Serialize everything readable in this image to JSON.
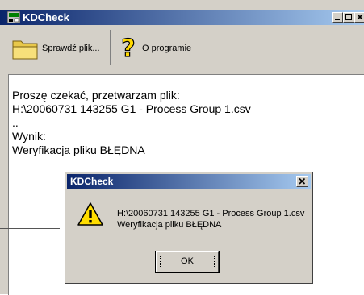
{
  "window": {
    "title": "KDCheck",
    "icon": "app-icon",
    "controls": [
      "minimize-icon",
      "maximize-icon",
      "close-icon"
    ]
  },
  "toolbar": {
    "check_label": "Sprawdź plik...",
    "check_icon": "folder-icon",
    "about_label": "O programie",
    "about_icon": "question-mark-icon"
  },
  "log": {
    "lines": [
      "Proszę czekać, przetwarzam plik:",
      "H:\\20060731 143255 G1 - Process Group 1.csv",
      "..",
      "Wynik:",
      "Weryfikacja pliku BŁĘDNA"
    ]
  },
  "dialog": {
    "title": "KDCheck",
    "icon": "warning-icon",
    "message_line1": "H:\\20060731 143255 G1 - Process Group 1.csv",
    "message_line2": "Weryfikacja pliku BŁĘDNA",
    "ok_label": "OK"
  },
  "colors": {
    "titlebar_start": "#0a246a",
    "titlebar_end": "#a6caf0",
    "face": "#d4d0c8",
    "warning_yellow": "#ffdd00"
  }
}
